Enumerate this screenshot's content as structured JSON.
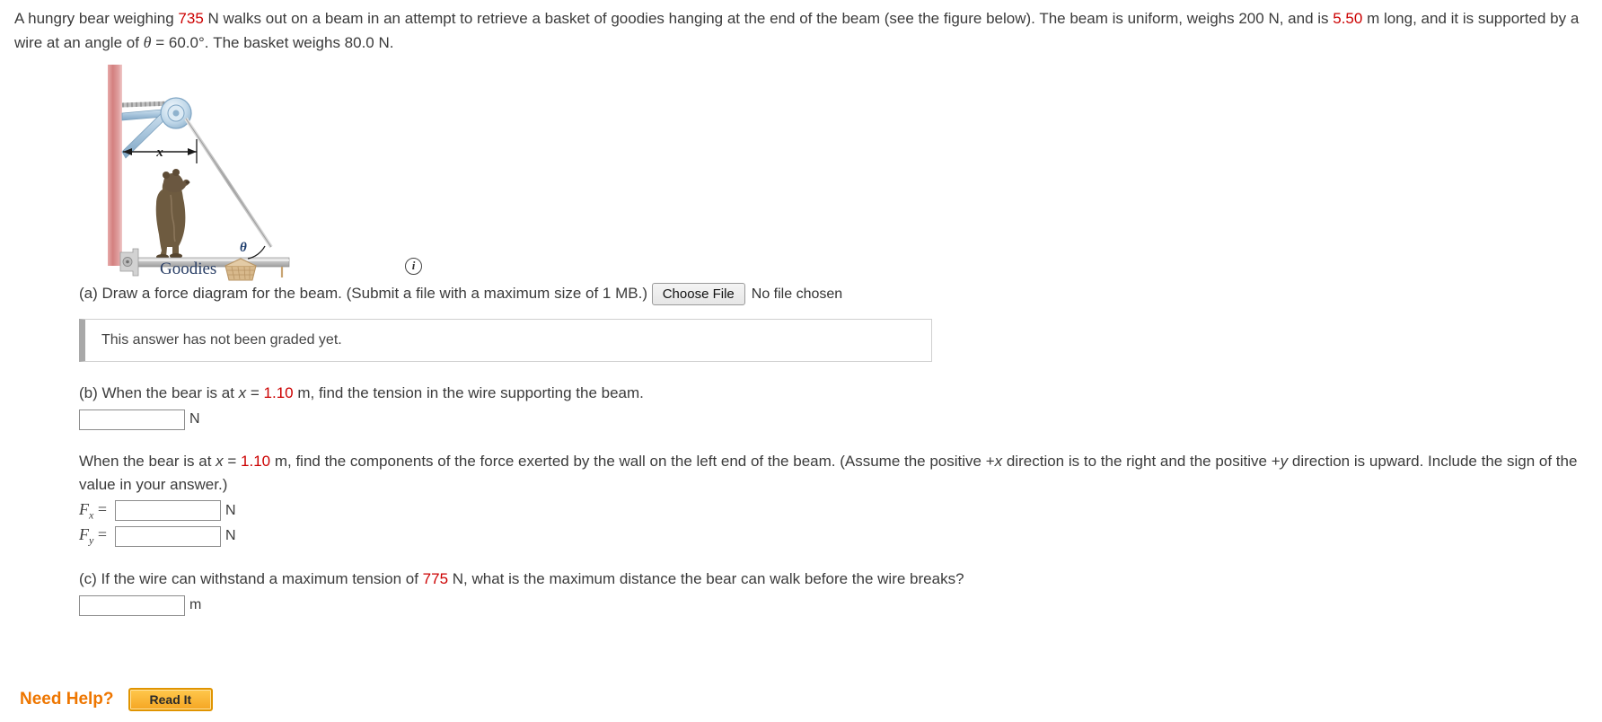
{
  "problem": {
    "text_1": "A hungry bear weighing ",
    "bear_weight": "735",
    "text_2": " N walks out on a beam in an attempt to retrieve a basket of goodies hanging at the end of the beam (see the figure below). The beam is uniform, weighs 200 N, and is ",
    "beam_length": "5.50",
    "text_3": " m long, and it is supported by a wire at an angle of ",
    "theta_symbol": "θ",
    "text_4": " = 60.0°. The basket weighs 80.0 N."
  },
  "figure": {
    "x_label": "x",
    "theta_label": "θ",
    "goodies_label": "Goodies",
    "info_icon_char": "i",
    "wall_color": "#d98a8a",
    "beam_color": "#c9c9c9",
    "wire_color": "#b8b8b8",
    "pulley_color": "#a9c6dd",
    "bear_color": "#6e5b40",
    "basket_color": "#c8a473"
  },
  "part_a": {
    "label": "(a) Draw a force diagram for the beam. (Submit a file with a maximum size of 1 MB.)",
    "choose_file_button": "Choose File",
    "no_file_text": "No file chosen",
    "graded_message": "This answer has not been graded yet."
  },
  "part_b": {
    "line_pre": "(b) When the bear is at ",
    "x_symbol": "x",
    "eq": " = ",
    "x_value": "1.10",
    "line_post": " m, find the tension in the wire supporting the beam.",
    "input_value": "",
    "unit": "N"
  },
  "components": {
    "line_pre": "When the bear is at ",
    "x_symbol": "x",
    "eq": " = ",
    "x_value": "1.10",
    "line_mid": " m, find the components of the force exerted by the wall on the left end of the beam. (Assume the positive +",
    "plus_x": "x",
    "line_mid2": " direction is to the right and the positive +",
    "plus_y": "y",
    "line_post": " direction is upward. Include the sign of the value in your answer.)",
    "fx_label": "F",
    "fx_sub": "x",
    "fy_label": "F",
    "fy_sub": "y",
    "equals": "=",
    "fx_value": "",
    "fy_value": "",
    "unit": "N"
  },
  "part_c": {
    "line_pre": "(c) If the wire can withstand a maximum tension of ",
    "tension_value": "775",
    "line_post": " N, what is the maximum distance the bear can walk before the wire breaks?",
    "input_value": "",
    "unit": "m"
  },
  "need_help": {
    "label": "Need Help?",
    "read_it_button": "Read It"
  }
}
